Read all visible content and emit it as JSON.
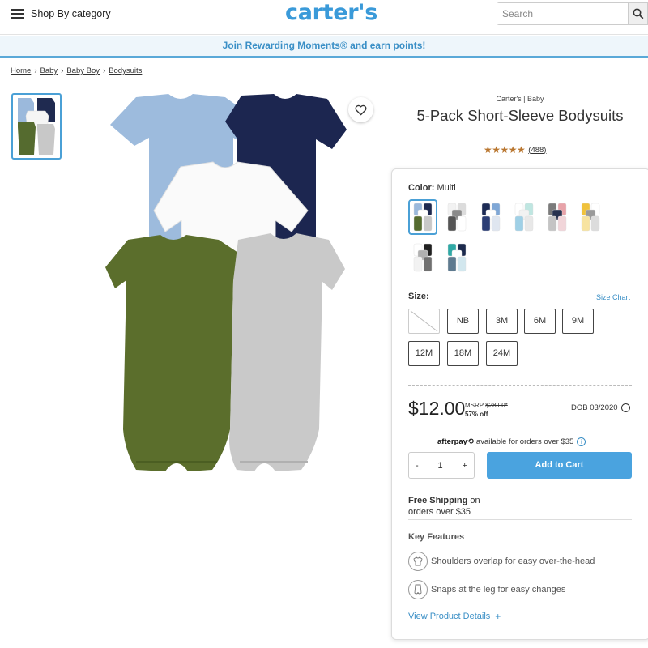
{
  "header": {
    "menu_label": "Shop By category",
    "logo": "carter's",
    "search_placeholder": "Search"
  },
  "promo": {
    "text": "Join Rewarding Moments® and earn points!"
  },
  "breadcrumbs": [
    "Home",
    "Baby",
    "Baby Boy",
    "Bodysuits"
  ],
  "product": {
    "brand": "Carter's | Baby",
    "title": "5-Pack Short-Sleeve Bodysuits",
    "stars": "★★★★★",
    "reviews": "(488)"
  },
  "color": {
    "label": "Color:",
    "value": "Multi",
    "swatches": [
      {
        "name": "blue-navy-white-green-grey",
        "colors": [
          "#9bb9dc",
          "#1f2a50",
          "#ffffff",
          "#556b2f",
          "#c8c8c8"
        ]
      },
      {
        "name": "white-grey",
        "colors": [
          "#f2f2f2",
          "#dcdcdc",
          "#8a8a8a",
          "#555555",
          "#ffffff"
        ]
      },
      {
        "name": "navy-blue-white",
        "colors": [
          "#1d2b55",
          "#7fa7d6",
          "#ffffff",
          "#2c3e75",
          "#dfe6f0"
        ]
      },
      {
        "name": "white-mint-pastel",
        "colors": [
          "#ffffff",
          "#bfe6e1",
          "#f2f2f2",
          "#9fd0e6",
          "#e8e8e8"
        ]
      },
      {
        "name": "grey-pink-navy",
        "colors": [
          "#7b7b7b",
          "#e8a3a9",
          "#28324f",
          "#c4c4c4",
          "#f1d5d9"
        ]
      },
      {
        "name": "yellow-white-grey",
        "colors": [
          "#f0c23c",
          "#ffffff",
          "#9a9a9a",
          "#f7e3a1",
          "#dcdcdc"
        ]
      },
      {
        "name": "white-black-grey",
        "colors": [
          "#ffffff",
          "#202020",
          "#b0b0b0",
          "#f2f2f2",
          "#707070"
        ]
      },
      {
        "name": "teal-navy",
        "colors": [
          "#2fa9a6",
          "#1c2a4d",
          "#ffffff",
          "#5e7a8f",
          "#d2e7ee"
        ]
      }
    ]
  },
  "size": {
    "label": "Size:",
    "chart_link": "Size Chart",
    "options": [
      "",
      "NB",
      "3M",
      "6M",
      "9M",
      "12M",
      "18M",
      "24M"
    ]
  },
  "pricing": {
    "price": "$12.00",
    "msrp_label": "MSRP",
    "msrp_value": "$28.00*",
    "discount": "57% off",
    "dob": "DOB 03/2020"
  },
  "afterpay": {
    "brand": "afterpay⟲",
    "text": "available for orders over $35",
    "info": "i"
  },
  "cart": {
    "minus": "-",
    "quantity": "1",
    "plus": "+",
    "button": "Add to Cart"
  },
  "shipping": {
    "bold": "Free Shipping",
    "text1": " on",
    "text2": "orders over $35"
  },
  "features": {
    "title": "Key Features",
    "items": [
      {
        "icon": "shoulder-icon",
        "text": "Shoulders overlap for easy over-the-head"
      },
      {
        "icon": "snap-icon",
        "text": "Snaps at the leg for easy changes"
      }
    ],
    "details_link": "View Product Details",
    "details_plus": "+"
  },
  "colors": {
    "brand_blue": "#3a9ad9",
    "button_blue": "#4aa3df",
    "star": "#b9762f"
  }
}
